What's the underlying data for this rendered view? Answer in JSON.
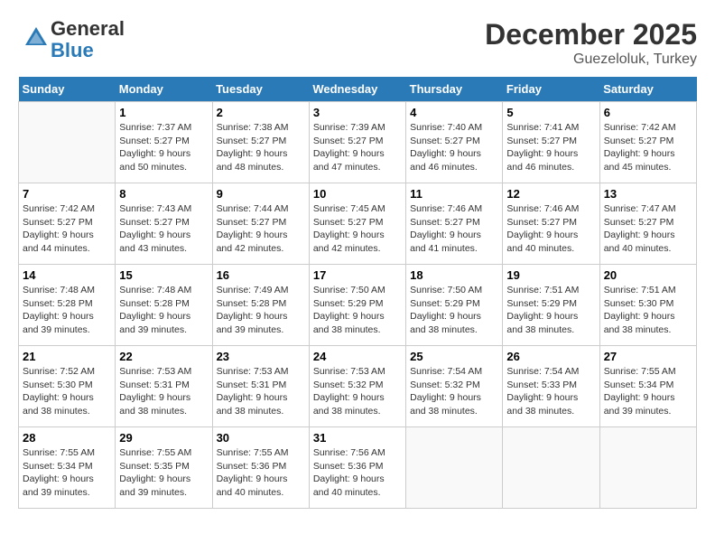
{
  "header": {
    "logo_general": "General",
    "logo_blue": "Blue",
    "month": "December 2025",
    "location": "Guezeloluk, Turkey"
  },
  "columns": [
    "Sunday",
    "Monday",
    "Tuesday",
    "Wednesday",
    "Thursday",
    "Friday",
    "Saturday"
  ],
  "weeks": [
    [
      {
        "day": "",
        "info": ""
      },
      {
        "day": "1",
        "info": "Sunrise: 7:37 AM\nSunset: 5:27 PM\nDaylight: 9 hours\nand 50 minutes."
      },
      {
        "day": "2",
        "info": "Sunrise: 7:38 AM\nSunset: 5:27 PM\nDaylight: 9 hours\nand 48 minutes."
      },
      {
        "day": "3",
        "info": "Sunrise: 7:39 AM\nSunset: 5:27 PM\nDaylight: 9 hours\nand 47 minutes."
      },
      {
        "day": "4",
        "info": "Sunrise: 7:40 AM\nSunset: 5:27 PM\nDaylight: 9 hours\nand 46 minutes."
      },
      {
        "day": "5",
        "info": "Sunrise: 7:41 AM\nSunset: 5:27 PM\nDaylight: 9 hours\nand 46 minutes."
      },
      {
        "day": "6",
        "info": "Sunrise: 7:42 AM\nSunset: 5:27 PM\nDaylight: 9 hours\nand 45 minutes."
      }
    ],
    [
      {
        "day": "7",
        "info": "Sunrise: 7:42 AM\nSunset: 5:27 PM\nDaylight: 9 hours\nand 44 minutes."
      },
      {
        "day": "8",
        "info": "Sunrise: 7:43 AM\nSunset: 5:27 PM\nDaylight: 9 hours\nand 43 minutes."
      },
      {
        "day": "9",
        "info": "Sunrise: 7:44 AM\nSunset: 5:27 PM\nDaylight: 9 hours\nand 42 minutes."
      },
      {
        "day": "10",
        "info": "Sunrise: 7:45 AM\nSunset: 5:27 PM\nDaylight: 9 hours\nand 42 minutes."
      },
      {
        "day": "11",
        "info": "Sunrise: 7:46 AM\nSunset: 5:27 PM\nDaylight: 9 hours\nand 41 minutes."
      },
      {
        "day": "12",
        "info": "Sunrise: 7:46 AM\nSunset: 5:27 PM\nDaylight: 9 hours\nand 40 minutes."
      },
      {
        "day": "13",
        "info": "Sunrise: 7:47 AM\nSunset: 5:27 PM\nDaylight: 9 hours\nand 40 minutes."
      }
    ],
    [
      {
        "day": "14",
        "info": "Sunrise: 7:48 AM\nSunset: 5:28 PM\nDaylight: 9 hours\nand 39 minutes."
      },
      {
        "day": "15",
        "info": "Sunrise: 7:48 AM\nSunset: 5:28 PM\nDaylight: 9 hours\nand 39 minutes."
      },
      {
        "day": "16",
        "info": "Sunrise: 7:49 AM\nSunset: 5:28 PM\nDaylight: 9 hours\nand 39 minutes."
      },
      {
        "day": "17",
        "info": "Sunrise: 7:50 AM\nSunset: 5:29 PM\nDaylight: 9 hours\nand 38 minutes."
      },
      {
        "day": "18",
        "info": "Sunrise: 7:50 AM\nSunset: 5:29 PM\nDaylight: 9 hours\nand 38 minutes."
      },
      {
        "day": "19",
        "info": "Sunrise: 7:51 AM\nSunset: 5:29 PM\nDaylight: 9 hours\nand 38 minutes."
      },
      {
        "day": "20",
        "info": "Sunrise: 7:51 AM\nSunset: 5:30 PM\nDaylight: 9 hours\nand 38 minutes."
      }
    ],
    [
      {
        "day": "21",
        "info": "Sunrise: 7:52 AM\nSunset: 5:30 PM\nDaylight: 9 hours\nand 38 minutes."
      },
      {
        "day": "22",
        "info": "Sunrise: 7:53 AM\nSunset: 5:31 PM\nDaylight: 9 hours\nand 38 minutes."
      },
      {
        "day": "23",
        "info": "Sunrise: 7:53 AM\nSunset: 5:31 PM\nDaylight: 9 hours\nand 38 minutes."
      },
      {
        "day": "24",
        "info": "Sunrise: 7:53 AM\nSunset: 5:32 PM\nDaylight: 9 hours\nand 38 minutes."
      },
      {
        "day": "25",
        "info": "Sunrise: 7:54 AM\nSunset: 5:32 PM\nDaylight: 9 hours\nand 38 minutes."
      },
      {
        "day": "26",
        "info": "Sunrise: 7:54 AM\nSunset: 5:33 PM\nDaylight: 9 hours\nand 38 minutes."
      },
      {
        "day": "27",
        "info": "Sunrise: 7:55 AM\nSunset: 5:34 PM\nDaylight: 9 hours\nand 39 minutes."
      }
    ],
    [
      {
        "day": "28",
        "info": "Sunrise: 7:55 AM\nSunset: 5:34 PM\nDaylight: 9 hours\nand 39 minutes."
      },
      {
        "day": "29",
        "info": "Sunrise: 7:55 AM\nSunset: 5:35 PM\nDaylight: 9 hours\nand 39 minutes."
      },
      {
        "day": "30",
        "info": "Sunrise: 7:55 AM\nSunset: 5:36 PM\nDaylight: 9 hours\nand 40 minutes."
      },
      {
        "day": "31",
        "info": "Sunrise: 7:56 AM\nSunset: 5:36 PM\nDaylight: 9 hours\nand 40 minutes."
      },
      {
        "day": "",
        "info": ""
      },
      {
        "day": "",
        "info": ""
      },
      {
        "day": "",
        "info": ""
      }
    ]
  ]
}
